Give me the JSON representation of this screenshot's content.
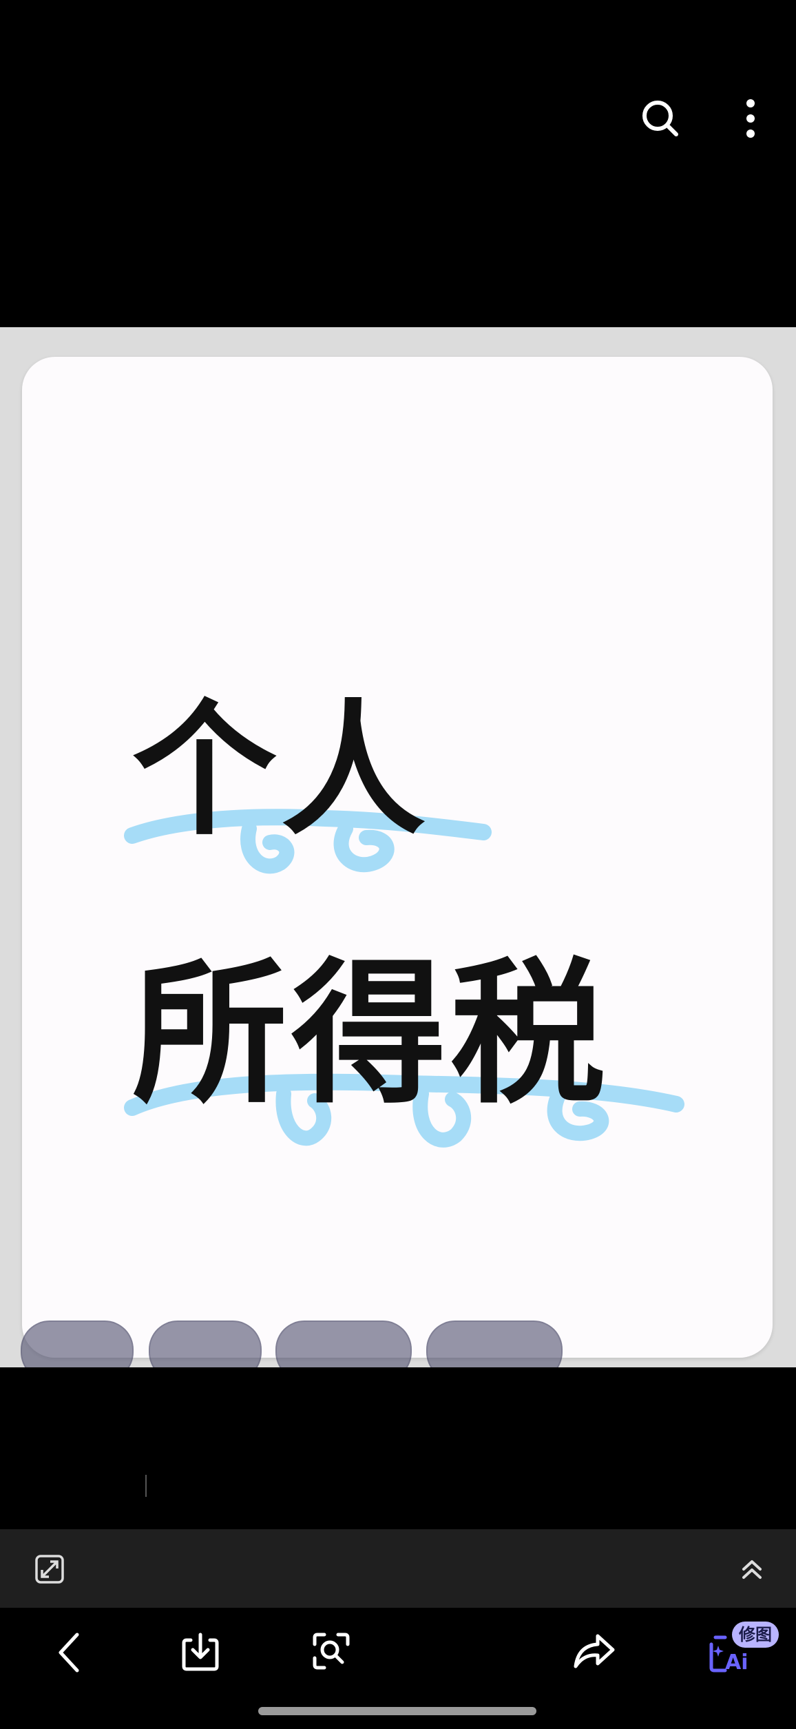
{
  "image": {
    "title_line1": "个人",
    "title_line2": "所得税"
  },
  "toolbar": {
    "ai_badge": "修图"
  },
  "colors": {
    "highlight": "#a6dcf7",
    "ai_accent": "#6a63ff",
    "badge_bg": "#b9b4ff"
  },
  "icons": [
    "search-icon",
    "more-options-icon",
    "crop-icon",
    "expand-up-icon",
    "back-icon",
    "download-icon",
    "lens-scan-icon",
    "share-icon",
    "ai-edit-icon"
  ]
}
